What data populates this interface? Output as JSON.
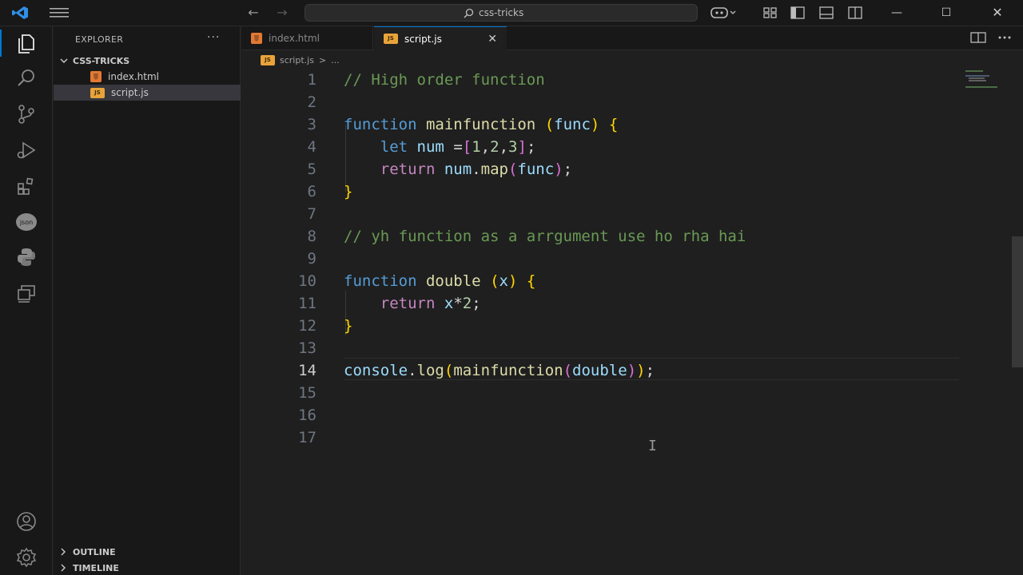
{
  "titlebar": {
    "search_text": "css-tricks",
    "nav_back": "←",
    "nav_forward": "→",
    "minimize": "—",
    "maximize": "☐",
    "close": "✕"
  },
  "sidebar": {
    "title": "EXPLORER",
    "more": "···",
    "folder": "CSS-TRICKS",
    "files": [
      {
        "name": "index.html",
        "type": "html"
      },
      {
        "name": "script.js",
        "type": "js"
      }
    ],
    "outline": "OUTLINE",
    "timeline": "TIMELINE"
  },
  "tabs": [
    {
      "label": "index.html",
      "active": false
    },
    {
      "label": "script.js",
      "active": true
    }
  ],
  "tab_close": "✕",
  "breadcrumb": {
    "file": "script.js",
    "sep": ">",
    "more": "..."
  },
  "editor": {
    "line_numbers": [
      "1",
      "2",
      "3",
      "4",
      "5",
      "6",
      "7",
      "8",
      "9",
      "10",
      "11",
      "12",
      "13",
      "14",
      "15",
      "16",
      "17"
    ],
    "current_line": 14,
    "code": {
      "l1": "// High order function",
      "l3_kw": "function",
      "l3_fn": "mainfunction",
      "l3_param": "func",
      "l4_kw": "let",
      "l4_var": "num",
      "l4_eq": " =",
      "l4_nums": [
        "1",
        "2",
        "3"
      ],
      "l5_kw": "return",
      "l5_var": "num",
      "l5_fn": "map",
      "l5_arg": "func",
      "l8": "// yh function as a arrgument use ho rha hai",
      "l10_kw": "function",
      "l10_fn": "double",
      "l10_param": "x",
      "l11_kw": "return",
      "l11_var": "x",
      "l11_op": "*",
      "l11_num": "2",
      "l14_obj": "console",
      "l14_fn": "log",
      "l14_call": "mainfunction",
      "l14_arg": "double"
    }
  },
  "icons": {
    "files": "files-icon",
    "search": "search-icon",
    "source_control": "source-control-icon",
    "run_debug": "run-debug-icon",
    "extensions": "extensions-icon",
    "json": "json-icon",
    "python": "python-icon",
    "remote": "remote-explorer-icon",
    "account": "account-icon",
    "settings": "gear-icon"
  },
  "colors": {
    "accent": "#0078d4",
    "comment": "#6a9955",
    "keyword": "#569cd6",
    "function": "#dcdcaa",
    "control": "#c586c0",
    "variable": "#9cdcfe",
    "number": "#b5cea8"
  }
}
